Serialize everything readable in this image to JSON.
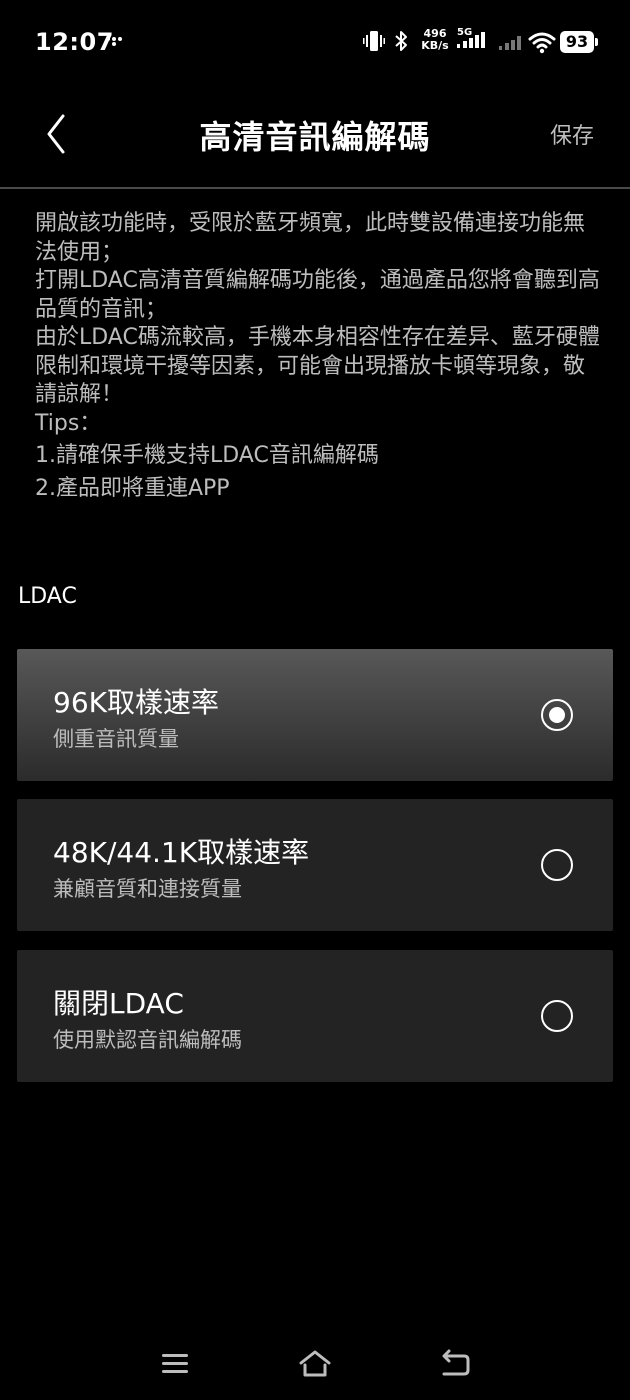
{
  "status_bar": {
    "time": "12:07",
    "net_speed_value": "496",
    "net_speed_unit": "KB/s",
    "network_type": "5G",
    "battery_level": "93"
  },
  "header": {
    "title": "高清音訊編解碼",
    "save_label": "保存",
    "back_icon": "chevron-left-icon"
  },
  "description": {
    "paragraphs": [
      "開啟該功能時，受限於藍牙頻寬，此時雙設備連接功能無法使用；",
      "打開LDAC高清音質編解碼功能後，通過產品您將會聽到高品質的音訊；",
      "由於LDAC碼流較高，手機本身相容性存在差异、藍牙硬體限制和環境干擾等因素，可能會出現播放卡頓等現象，敬請諒解！",
      "Tips：",
      "1.請確保手機支持LDAC音訊編解碼",
      "2.產品即將重連APP"
    ]
  },
  "section": {
    "label": "LDAC"
  },
  "options": [
    {
      "title": "96K取樣速率",
      "subtitle": "側重音訊質量",
      "selected": true
    },
    {
      "title": "48K/44.1K取樣速率",
      "subtitle": "兼顧音質和連接質量",
      "selected": false
    },
    {
      "title": "關閉LDAC",
      "subtitle": "使用默認音訊編解碼",
      "selected": false
    }
  ],
  "colors": {
    "background": "#000000",
    "card": "#232323",
    "selected_card_top": "#585858",
    "secondary_text": "#bdbdbd",
    "divider": "#4a4a4a"
  },
  "nav_bar": {
    "icons": [
      "menu-icon",
      "home-icon",
      "back-icon"
    ]
  }
}
